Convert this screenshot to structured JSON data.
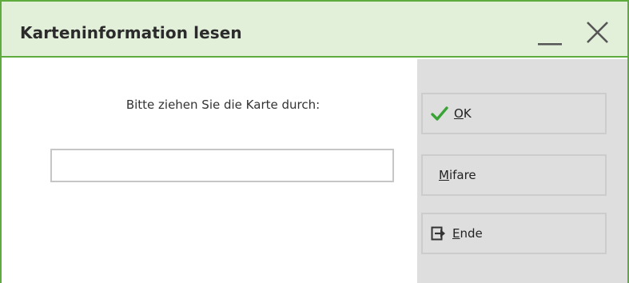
{
  "window": {
    "title": "Karteninformation lesen",
    "minimize_icon": "minimize-icon",
    "close_icon": "close-icon"
  },
  "main": {
    "prompt": "Bitte ziehen Sie die Karte durch:",
    "card_input": {
      "value": "",
      "placeholder": ""
    }
  },
  "buttons": {
    "ok": {
      "label_mnemonic": "O",
      "label_rest": "K",
      "icon": "checkmark-icon"
    },
    "mifare": {
      "label_mnemonic": "M",
      "label_rest": "ifare"
    },
    "ende": {
      "label_mnemonic": "E",
      "label_rest": "nde",
      "icon": "exit-icon"
    }
  },
  "colors": {
    "frame": "#5fac3e",
    "titlebar": "#e2efd9",
    "side_panel": "#dedede",
    "check": "#3aa336"
  }
}
